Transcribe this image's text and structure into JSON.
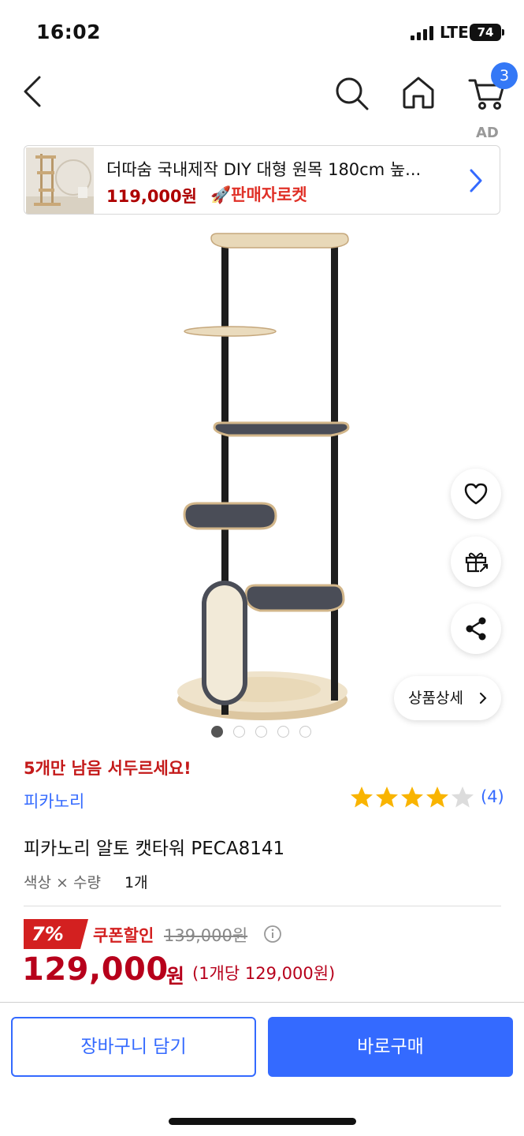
{
  "status_bar": {
    "time": "16:02",
    "network": "LTE",
    "battery": "74"
  },
  "nav": {
    "back_icon": "chevron-left-icon",
    "search_icon": "search-icon",
    "home_icon": "home-icon",
    "cart_icon": "cart-icon",
    "cart_count": "3",
    "accent_color": "#3478f6"
  },
  "ad": {
    "label": "AD",
    "title": "더따숨 국내제작 DIY 대형 원목 180cm 높...",
    "price": "119,000원",
    "rocket": "판매자로켓",
    "rocket_icon": "rocket-icon",
    "chevron_icon": "chevron-right-icon"
  },
  "gallery": {
    "image": "cat-tower-product-image",
    "dot_count": 5,
    "active_dot": 1
  },
  "floating": {
    "like_icon": "heart-icon",
    "gift_icon": "gift-icon",
    "share_icon": "share-icon",
    "detail_label": "상품상세"
  },
  "product": {
    "stock_warning": "5개만 남음 서두르세요!",
    "brand": "피카노리",
    "rating": 4,
    "rating_max": 5,
    "review_count": "(4)",
    "title": "피카노리 알토 캣타워 PECA8141",
    "option_label": "색상 × 수량",
    "option_value": "1개"
  },
  "price": {
    "discount": "7%",
    "coupon_label": "쿠폰할인",
    "original": "139,000원",
    "final_number": "129,000",
    "final_unit": "원",
    "unit_price": "(1개당 129,000원)",
    "sale_color": "#b7001b"
  },
  "actions": {
    "add_to_cart": "장바구니 담기",
    "buy_now": "바로구매",
    "primary_color": "#346aff"
  }
}
